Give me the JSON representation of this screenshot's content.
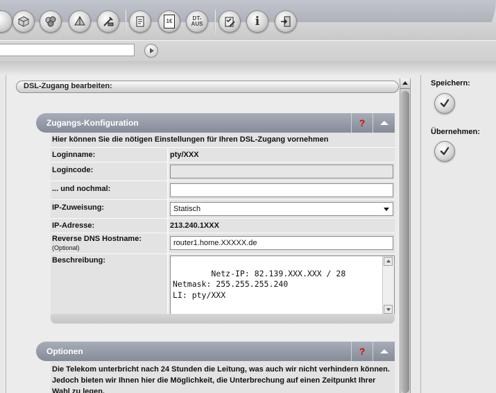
{
  "toolbar": {
    "buttons": [
      {
        "icon": "cube-icon"
      },
      {
        "icon": "multi-cube-icon"
      },
      {
        "icon": "pyramid-icon"
      },
      {
        "icon": "tools-icon"
      },
      {
        "icon": "document-icon"
      },
      {
        "icon": "invoice-icon",
        "text": "1€"
      },
      {
        "icon": "dt-aus-icon",
        "text_line1": "DT-",
        "text_line2": "AUS"
      },
      {
        "icon": "checklist-tools-icon"
      },
      {
        "icon": "info-icon",
        "text": "i"
      },
      {
        "icon": "exit-icon"
      }
    ]
  },
  "address_bar": {
    "value": ""
  },
  "page": {
    "breadcrumb_title": "DSL-Zugang bearbeiten:"
  },
  "section_config": {
    "title": "Zugangs-Konfiguration",
    "help_label": "?",
    "intro": "Hier können Sie die nötigen Einstellungen für Ihren DSL-Zugang vornehmen",
    "fields": {
      "loginname_label": "Loginname:",
      "loginname_value": "pty/XXX",
      "logincode_label": "Logincode:",
      "logincode_value": "",
      "repeat_label": "... und nochmal:",
      "repeat_value": "",
      "ip_assign_label": "IP-Zuweisung:",
      "ip_assign_value": "Statisch",
      "ip_address_label": "IP-Adresse:",
      "ip_address_value": "213.240.1XXX",
      "rdns_label": "Reverse DNS Hostname:",
      "rdns_sublabel": "(Optional)",
      "rdns_value": "router1.home.XXXXX.de",
      "description_label": "Beschreibung:",
      "description_value": "Netz-IP: 82.139.XXX.XXX / 28\nNetmask: 255.255.255.240\nLI: pty/XXX"
    }
  },
  "section_options": {
    "title": "Optionen",
    "help_label": "?",
    "text": "Die Telekom unterbricht nach 24 Stunden die Leitung, was auch wir nicht verhindern können. Jedoch bieten wir Ihnen hier die Möglichkeit, die Unterbrechung auf einen Zeitpunkt Ihrer Wahl zu legen."
  },
  "side_actions": {
    "save_label": "Speichern:",
    "apply_label": "Übernehmen:"
  },
  "colors": {
    "section_header": "#8f96a2",
    "help_mark": "#e00000",
    "panel_bg": "#e3e3e3"
  }
}
